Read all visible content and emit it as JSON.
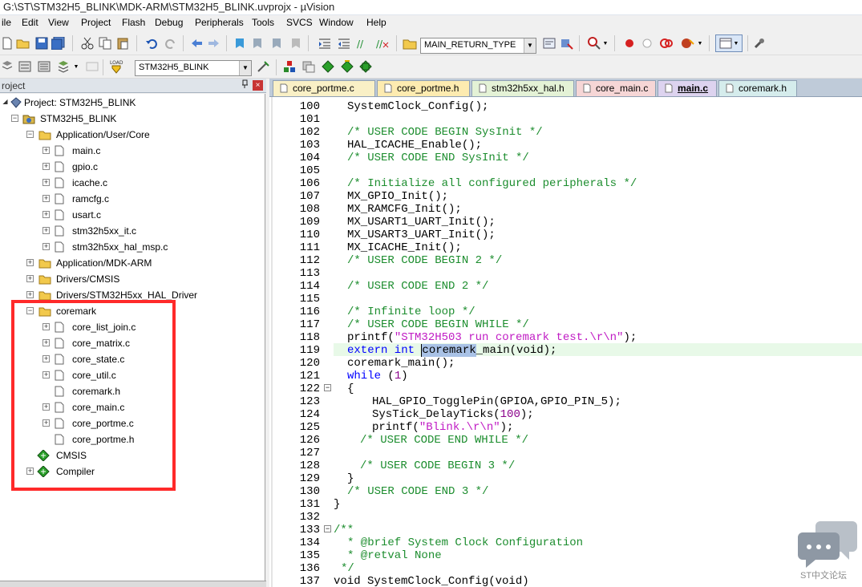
{
  "window": {
    "title": "G:\\ST\\STM32H5_BLINK\\MDK-ARM\\STM32H5_BLINK.uvprojx - µVision"
  },
  "menu": [
    "ile",
    "Edit",
    "View",
    "Project",
    "Flash",
    "Debug",
    "Peripherals",
    "Tools",
    "SVCS",
    "Window",
    "Help"
  ],
  "toolbar": {
    "find_combo": "MAIN_RETURN_TYPE",
    "target_combo": "STM32H5_BLINK",
    "load_label": "LOAD"
  },
  "project_panel": {
    "title": "roject",
    "pin": " ",
    "close": "×",
    "project_label": "Project: STM32H5_BLINK",
    "target": "STM32H5_BLINK",
    "groups": {
      "core": "Application/User/Core",
      "mdkarm": "Application/MDK-ARM",
      "cmsis_drv": "Drivers/CMSIS",
      "hal": "Drivers/STM32H5xx_HAL_Driver",
      "coremark": "coremark"
    },
    "core_files": [
      "main.c",
      "gpio.c",
      "icache.c",
      "ramcfg.c",
      "usart.c",
      "stm32h5xx_it.c",
      "stm32h5xx_hal_msp.c"
    ],
    "coremark_files": [
      "core_list_join.c",
      "core_matrix.c",
      "core_state.c",
      "core_util.c",
      "coremark.h",
      "core_main.c",
      "core_portme.c",
      "core_portme.h"
    ],
    "cmsis_component": "CMSIS",
    "compiler_component": "Compiler"
  },
  "editor": {
    "tabs": [
      "core_portme.c",
      "core_portme.h",
      "stm32h5xx_hal.h",
      "core_main.c",
      "main.c",
      "coremark.h"
    ],
    "active_tab": "main.c",
    "line_numbers": [
      "100",
      "101",
      "102",
      "103",
      "104",
      "105",
      "106",
      "107",
      "108",
      "109",
      "110",
      "111",
      "112",
      "113",
      "114",
      "115",
      "116",
      "117",
      "118",
      "119",
      "120",
      "121",
      "122",
      "123",
      "124",
      "125",
      "126",
      "127",
      "128",
      "129",
      "130",
      "131",
      "132",
      "133",
      "134",
      "135",
      "136",
      "137"
    ],
    "code": {
      "l100": "SystemClock_Config();",
      "l102": "/* USER CODE BEGIN SysInit */",
      "l103": "HAL_ICACHE_Enable();",
      "l104": "/* USER CODE END SysInit */",
      "l106": "/* Initialize all configured peripherals */",
      "l107": "MX_GPIO_Init();",
      "l108": "MX_RAMCFG_Init();",
      "l109": "MX_USART1_UART_Init();",
      "l110": "MX_USART3_UART_Init();",
      "l111": "MX_ICACHE_Init();",
      "l112": "/* USER CODE BEGIN 2 */",
      "l114": "/* USER CODE END 2 */",
      "l116": "/* Infinite loop */",
      "l117": "/* USER CODE BEGIN WHILE */",
      "l118_fn": "printf(",
      "l118_str": "\"STM32H503 run coremark test.\\r\\n\"",
      "l118_end": ");",
      "l119_kw": "extern int ",
      "l119_sel": "coremark",
      "l119_rest": "_main(void);",
      "l120": "coremark_main();",
      "l121_kw": "while",
      "l121_open": " (",
      "l121_num": "1",
      "l121_close": ")",
      "l122": "{",
      "l123": "HAL_GPIO_TogglePin(GPIOA,GPIO_PIN_5);",
      "l124_fn": "SysTick_DelayTicks(",
      "l124_num": "100",
      "l124_end": ");",
      "l125_fn": "printf(",
      "l125_str": "\"Blink.\\r\\n\"",
      "l125_end": ");",
      "l126": "/* USER CODE END WHILE */",
      "l128": "/* USER CODE BEGIN 3 */",
      "l129": "}",
      "l130": "/* USER CODE END 3 */",
      "l131": "}",
      "l133": "/**",
      "l134": "* @brief System Clock Configuration",
      "l135": "* @retval None",
      "l136": "*/",
      "l137": "void SystemClock_Config(void)"
    }
  },
  "watermark": {
    "text": "ST中文论坛"
  }
}
